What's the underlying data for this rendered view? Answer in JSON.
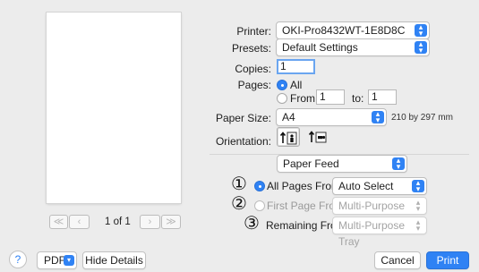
{
  "preview": {
    "page_count": "1 of 1",
    "first_page_icon": "first-page-icon",
    "prev_page_icon": "prev-page-icon",
    "next_page_icon": "next-page-icon",
    "last_page_icon": "last-page-icon"
  },
  "printer": {
    "label": "Printer:",
    "value": "OKI-Pro8432WT-1E8D8C"
  },
  "presets": {
    "label": "Presets:",
    "value": "Default Settings"
  },
  "copies": {
    "label": "Copies:",
    "value": "1"
  },
  "pages": {
    "label": "Pages:",
    "all_label": "All",
    "from_label": "From:",
    "from_value": "1",
    "to_label": "to:",
    "to_value": "1",
    "selected": "All"
  },
  "paper_size": {
    "label": "Paper Size:",
    "value": "A4",
    "dimensions": "210 by 297 mm"
  },
  "orientation": {
    "label": "Orientation:",
    "selected": "portrait"
  },
  "section": {
    "value": "Paper Feed"
  },
  "paper_feed": {
    "rows": [
      {
        "marker": "①",
        "label": "All Pages From:",
        "value": "Auto Select",
        "enabled": true,
        "selected": true
      },
      {
        "marker": "②",
        "label": "First Page From:",
        "value": "Multi-Purpose Tray",
        "enabled": false,
        "selected": false
      },
      {
        "marker": "③",
        "label": "Remaining From:",
        "value": "Multi-Purpose Tray",
        "enabled": false,
        "selected": false
      }
    ]
  },
  "bottom": {
    "help_label": "?",
    "pdf_label": "PDF",
    "hide_details_label": "Hide Details",
    "cancel_label": "Cancel",
    "print_label": "Print"
  },
  "colors": {
    "accent": "#2f82f4",
    "background": "#ececec"
  }
}
